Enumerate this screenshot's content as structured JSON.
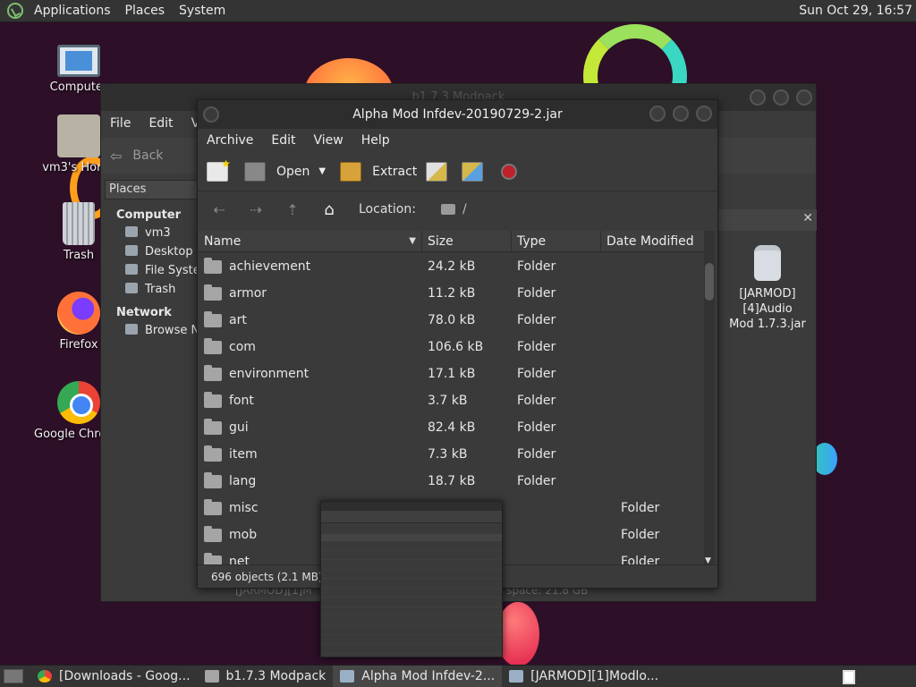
{
  "top_panel": {
    "menus": [
      "Applications",
      "Places",
      "System"
    ],
    "clock": "Sun Oct 29, 16:57"
  },
  "desktop_icons": [
    {
      "label": "Computer"
    },
    {
      "label": "vm3's Home"
    },
    {
      "label": "Trash"
    },
    {
      "label": "Firefox"
    },
    {
      "label": "Google Chrome"
    }
  ],
  "file_manager": {
    "title": "b1.7.3 Modpack",
    "menus": [
      "File",
      "Edit",
      "Vi"
    ],
    "back_label": "Back",
    "places_label": "Places",
    "sidebar": {
      "computer_heading": "Computer",
      "computer_items": [
        "vm3",
        "Desktop",
        "File System",
        "Trash"
      ],
      "network_heading": "Network",
      "network_items": [
        "Browse Network"
      ]
    },
    "close_glyph": "✕",
    "jar_label_line1": "[JARMOD][4]Audio",
    "jar_label_line2": "Mod 1.7.3.jar",
    "status_left": "[JARMOD][1]M",
    "status_right": "e space: 21.8 GB"
  },
  "archive": {
    "title": "Alpha Mod Infdev-20190729-2.jar",
    "menus": [
      "Archive",
      "Edit",
      "View",
      "Help"
    ],
    "toolbar": {
      "open_label": "Open",
      "extract_label": "Extract"
    },
    "location_label": "Location:",
    "location_path": "/",
    "columns": {
      "name": "Name",
      "size": "Size",
      "type": "Type",
      "date": "Date Modified"
    },
    "rows": [
      {
        "name": "achievement",
        "size": "24.2 kB",
        "type": "Folder"
      },
      {
        "name": "armor",
        "size": "11.2 kB",
        "type": "Folder"
      },
      {
        "name": "art",
        "size": "78.0 kB",
        "type": "Folder"
      },
      {
        "name": "com",
        "size": "106.6 kB",
        "type": "Folder"
      },
      {
        "name": "environment",
        "size": "17.1 kB",
        "type": "Folder"
      },
      {
        "name": "font",
        "size": "3.7 kB",
        "type": "Folder"
      },
      {
        "name": "gui",
        "size": "82.4 kB",
        "type": "Folder"
      },
      {
        "name": "item",
        "size": "7.3 kB",
        "type": "Folder"
      },
      {
        "name": "lang",
        "size": "18.7 kB",
        "type": "Folder"
      },
      {
        "name": "misc",
        "size": "",
        "type": "Folder"
      },
      {
        "name": "mob",
        "size": "",
        "type": "Folder"
      },
      {
        "name": "net",
        "size": "",
        "type": "Folder"
      }
    ],
    "status": "696 objects (2.1 MB)"
  },
  "taskbar": {
    "tasks": [
      {
        "label": "[Downloads - Goog...",
        "icon": "chrome-icon"
      },
      {
        "label": "b1.7.3 Modpack",
        "icon": "folder-icon"
      },
      {
        "label": "Alpha Mod Infdev-2...",
        "icon": "archive-icon",
        "active": true
      },
      {
        "label": "[JARMOD][1]Modlo...",
        "icon": "archive-icon"
      }
    ]
  }
}
